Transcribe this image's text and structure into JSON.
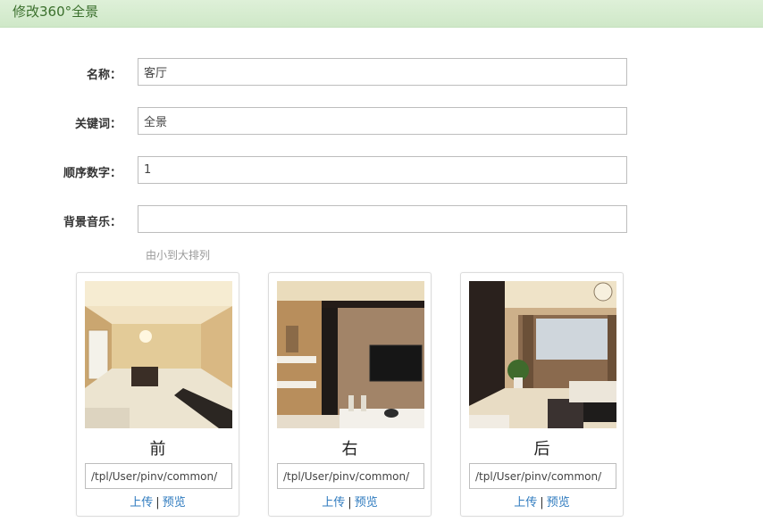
{
  "header": {
    "title": "修改360°全景"
  },
  "form": {
    "fields": [
      {
        "label": "名称：",
        "value": "客厅",
        "placeholder": ""
      },
      {
        "label": "关键词：",
        "value": "全景",
        "placeholder": ""
      },
      {
        "label": "顺序数字：",
        "value": "1",
        "placeholder": ""
      },
      {
        "label": "背景音乐：",
        "value": "",
        "placeholder": ""
      }
    ],
    "hint": "由小到大排列"
  },
  "cards": [
    {
      "title": "前",
      "path": "/tpl/User/pinv/common/",
      "upload": "上传",
      "preview": "预览"
    },
    {
      "title": "右",
      "path": "/tpl/User/pinv/common/",
      "upload": "上传",
      "preview": "预览"
    },
    {
      "title": "后",
      "path": "/tpl/User/pinv/common/",
      "upload": "上传",
      "preview": "预览"
    }
  ],
  "colors": {
    "header_bg": "#d6ecd0",
    "header_text": "#3a6f2c",
    "link": "#2f7bbf"
  }
}
